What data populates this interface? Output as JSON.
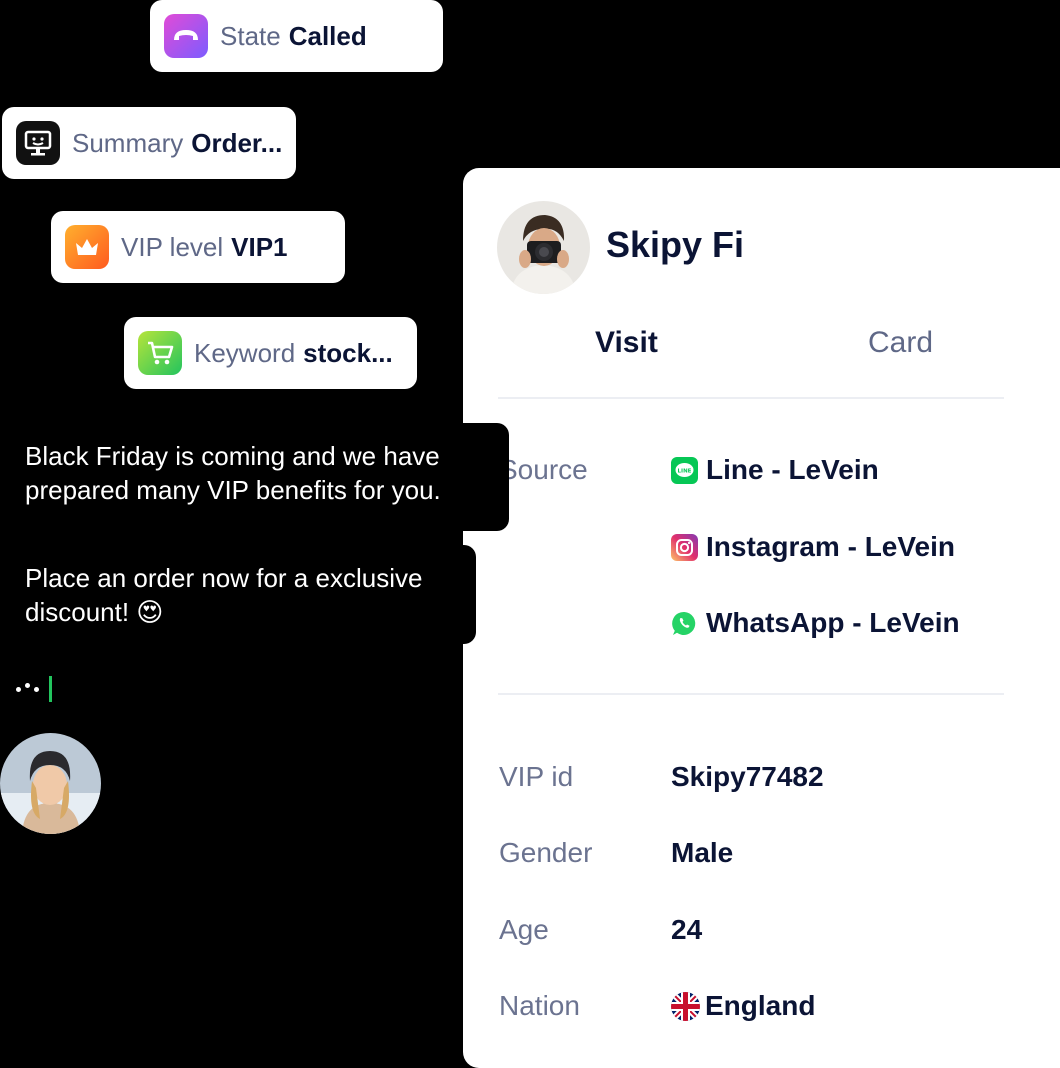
{
  "chips": [
    {
      "label": "State",
      "value": "Called",
      "icon": "phone-hangup-icon"
    },
    {
      "label": "Summary",
      "value": "Order...",
      "icon": "monitor-icon"
    },
    {
      "label": "VIP level",
      "value": "VIP1",
      "icon": "crown-icon"
    },
    {
      "label": "Keyword",
      "value": "stock...",
      "icon": "shopping-cart-icon"
    }
  ],
  "chat": {
    "message1": "Black Friday is coming and we have prepared many VIP benefits for you.",
    "message2": "Place an order now for a exclusive discount! 😍"
  },
  "profile": {
    "name": "Skipy Fi",
    "tabs": [
      {
        "label": "Visit",
        "active": true
      },
      {
        "label": "Card",
        "active": false
      }
    ],
    "source_label": "Source",
    "sources": [
      {
        "name": "Line - LeVein",
        "icon": "line-icon"
      },
      {
        "name": "Instagram - LeVein",
        "icon": "instagram-icon"
      },
      {
        "name": "WhatsApp - LeVein",
        "icon": "whatsapp-icon"
      }
    ],
    "fields": [
      {
        "label": "VIP id",
        "value": "Skipy77482"
      },
      {
        "label": "Gender",
        "value": "Male"
      },
      {
        "label": "Age",
        "value": "24"
      },
      {
        "label": "Nation",
        "value": "England",
        "icon": "uk-flag-icon"
      }
    ]
  },
  "colors": {
    "text_dark": "#0b1435",
    "text_muted": "#5f6887",
    "typing_caret": "#22c55e"
  }
}
